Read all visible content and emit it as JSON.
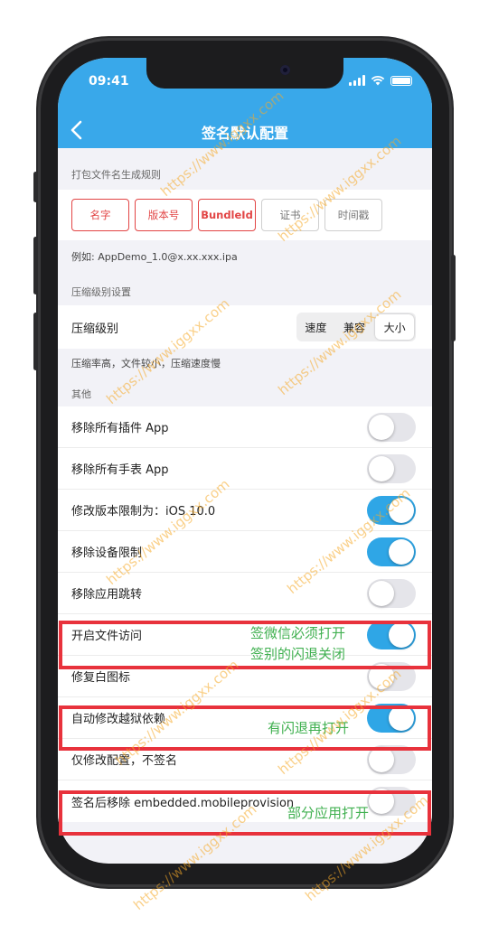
{
  "status": {
    "time": "09:41"
  },
  "nav": {
    "title": "签名默认配置"
  },
  "naming": {
    "header": "打包文件名生成规则",
    "tags": [
      {
        "label": "名字",
        "active": true
      },
      {
        "label": "版本号",
        "active": true
      },
      {
        "label": "BundleId",
        "active": true
      },
      {
        "label": "证书",
        "active": false
      },
      {
        "label": "时间戳",
        "active": false
      }
    ],
    "example": "例如: AppDemo_1.0@x.xx.xxx.ipa"
  },
  "compression": {
    "header": "压缩级别设置",
    "label": "压缩级别",
    "options": [
      "速度",
      "兼容",
      "大小"
    ],
    "selected": "大小",
    "note": "压缩率高，文件较小，压缩速度慢"
  },
  "other": {
    "header": "其他",
    "rows": [
      {
        "label": "移除所有插件 App",
        "on": false
      },
      {
        "label": "移除所有手表 App",
        "on": false
      },
      {
        "label": "修改版本限制为：iOS 10.0",
        "on": true
      },
      {
        "label": "移除设备限制",
        "on": true
      },
      {
        "label": "移除应用跳转",
        "on": false
      },
      {
        "label": "开启文件访问",
        "on": true
      },
      {
        "label": "修复白图标",
        "on": false
      },
      {
        "label": "自动修改越狱依赖",
        "on": true
      },
      {
        "label": "仅修改配置，不签名",
        "on": false
      },
      {
        "label": "签名后移除 embedded.mobileprovision",
        "on": false
      }
    ]
  },
  "annotations": {
    "file_access": "签微信必须打开\n签别的闪退关闭",
    "jailbreak": "有闪退再打开",
    "mobileprovision": "部分应用打开"
  },
  "watermark": "https://www.iggxx.com",
  "colors": {
    "accent": "#39a8ea",
    "toggle_on": "#2fa6e6",
    "tag_red": "#e24545",
    "annotation_green": "#40b050",
    "highlight_box": "#e8323c"
  }
}
